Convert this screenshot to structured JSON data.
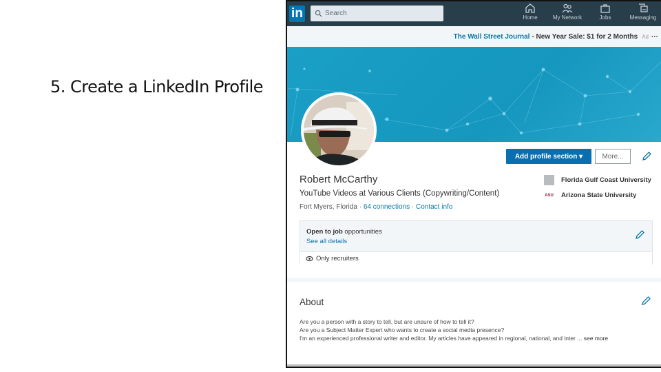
{
  "slide": {
    "title": "5. Create a LinkedIn Profile"
  },
  "topbar": {
    "logo": "in",
    "search_placeholder": "Search",
    "nav": [
      {
        "label": "Home",
        "icon": "home-icon"
      },
      {
        "label": "My Network",
        "icon": "network-icon"
      },
      {
        "label": "Jobs",
        "icon": "briefcase-icon"
      },
      {
        "label": "Messaging",
        "icon": "messaging-icon"
      }
    ]
  },
  "ad": {
    "brand": "The Wall Street Journal",
    "text": "- New Year Sale: $1 for 2 Months",
    "tag": "Ad",
    "more": "···"
  },
  "profile": {
    "name": "Robert McCarthy",
    "headline": "YouTube Videos at Various Clients (Copywriting/Content)",
    "location": "Fort Myers, Florida",
    "connections": "64 connections",
    "contact": "Contact info",
    "separator": "·",
    "add_section_label": "Add profile section ▾",
    "more_label": "More...",
    "education": [
      {
        "name": "Florida Gulf Coast University",
        "logo_text": ""
      },
      {
        "name": "Arizona State University",
        "logo_text": "ASU"
      }
    ]
  },
  "job_opportunities": {
    "title_bold": "Open to job",
    "title_rest": " opportunities",
    "link": "See all details",
    "visibility": "Only recruiters"
  },
  "about": {
    "title": "About",
    "lines": [
      "Are you a person with a story to tell, but are unsure of how to tell it?",
      "Are you a Subject Matter Expert who wants to create a social media presence?",
      "I'm an experienced professional writer and editor. My articles have appeared in regional, national, and inter"
    ],
    "see_more": "... see more"
  },
  "colors": {
    "brand_blue": "#0077b5",
    "link": "#0a76a8",
    "topbar": "#283e4a",
    "banner": "#1a9fc6"
  }
}
